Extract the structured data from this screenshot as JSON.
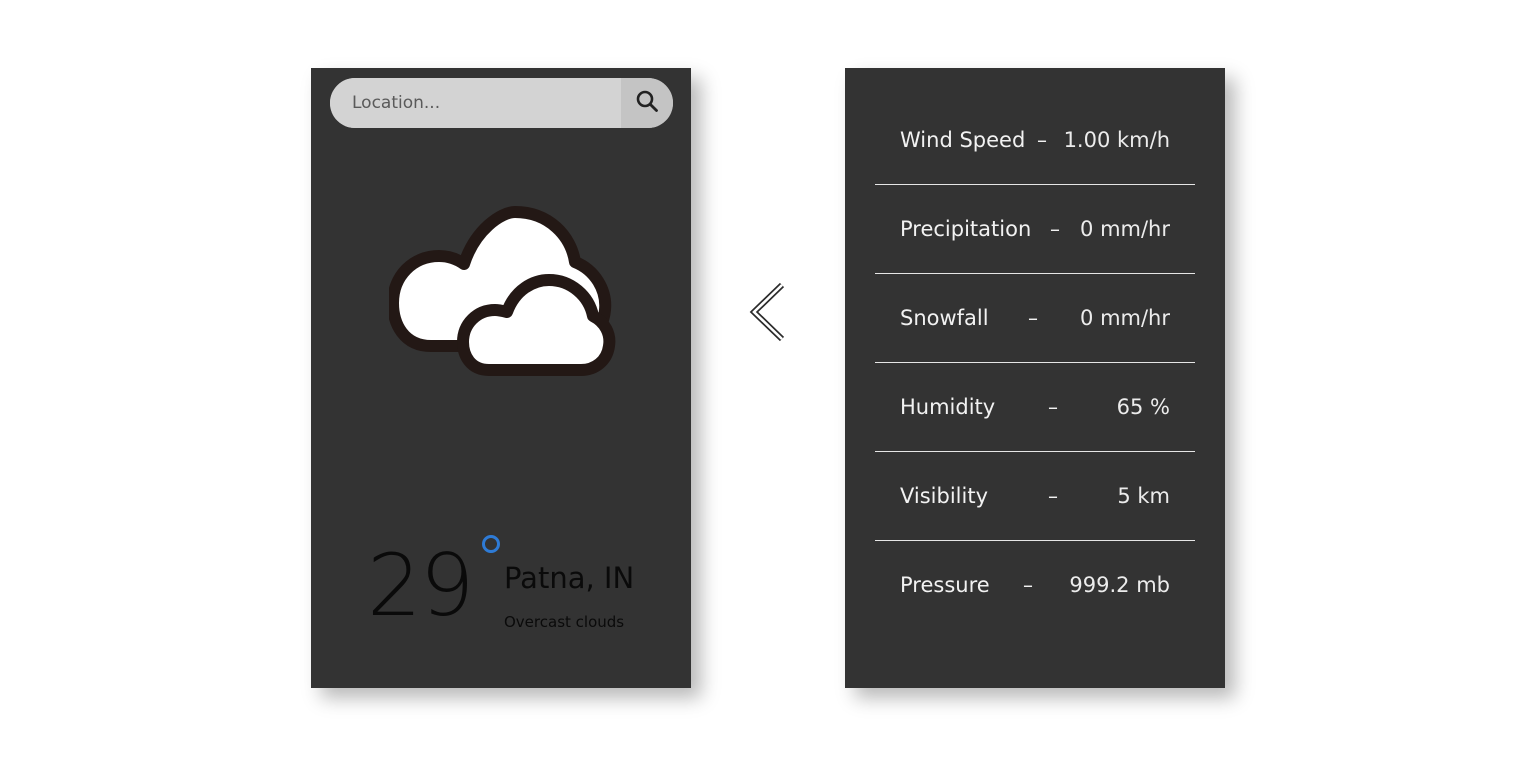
{
  "search": {
    "placeholder": "Location..."
  },
  "current": {
    "temperature": "29",
    "location": "Patna, IN",
    "description": "Overcast clouds",
    "icon": "cloudy-icon"
  },
  "nav": {
    "icon": "chevron-left-icon"
  },
  "stats": [
    {
      "label": "Wind Speed",
      "dash": "–",
      "value": "1.00 km/h"
    },
    {
      "label": "Precipitation",
      "dash": "–",
      "value": "0 mm/hr"
    },
    {
      "label": "Snowfall",
      "dash": "–",
      "value": "0 mm/hr"
    },
    {
      "label": "Humidity",
      "dash": "–",
      "value": "65 %"
    },
    {
      "label": "Visibility",
      "dash": "–",
      "value": "5 km"
    },
    {
      "label": "Pressure",
      "dash": "–",
      "value": "999.2 mb"
    }
  ],
  "colors": {
    "panel_bg": "#333333",
    "degree_accent": "#2e7bd6",
    "search_bg": "#d3d3d3"
  }
}
